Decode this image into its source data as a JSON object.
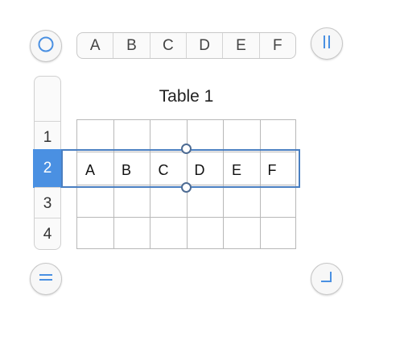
{
  "column_bar": {
    "labels": [
      "A",
      "B",
      "C",
      "D",
      "E",
      "F"
    ]
  },
  "row_bar": {
    "labels": [
      "1",
      "2",
      "3",
      "4"
    ],
    "selected_row": "2"
  },
  "table": {
    "title": "Table 1",
    "selected_row_cells": [
      "A",
      "B",
      "C",
      "D",
      "E",
      "F"
    ]
  },
  "icons": {
    "top_left": "select-table-circle-icon",
    "top_right": "column-pause-icon",
    "bottom_left": "row-equals-icon",
    "bottom_right": "resize-corner-icon"
  },
  "colors": {
    "accent": "#4a90e2",
    "selection_border": "#4a7fc1",
    "grid_line": "#b8b8b8"
  }
}
